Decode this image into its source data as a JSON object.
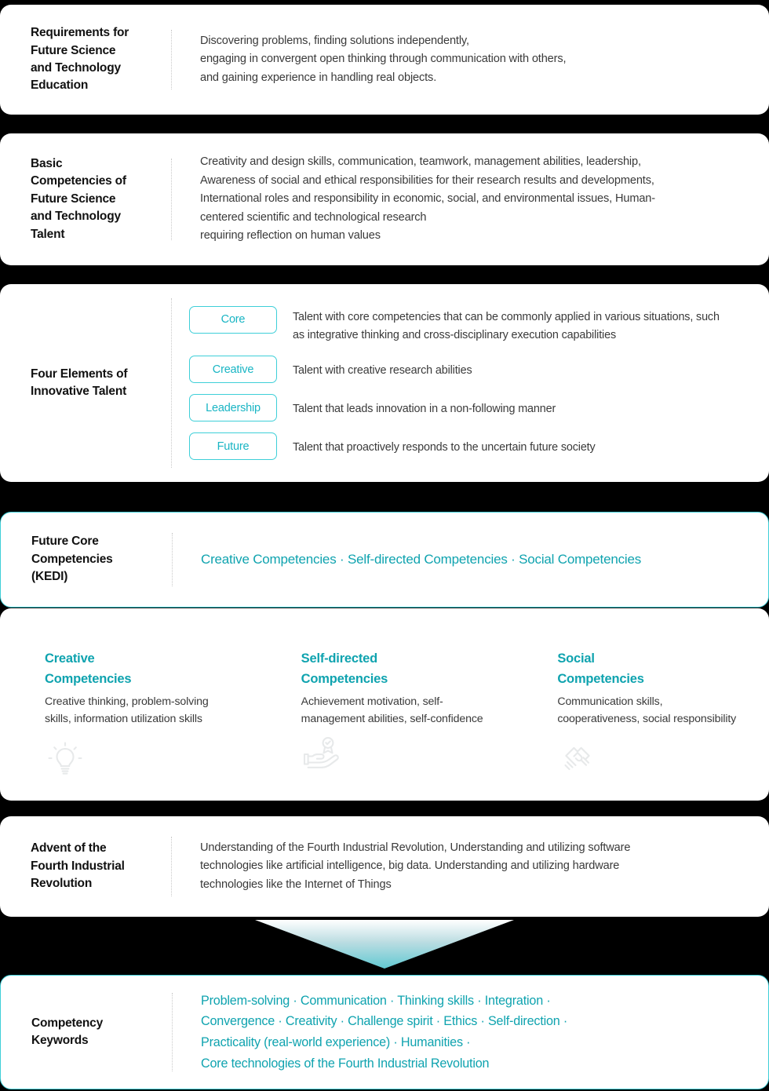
{
  "sections": {
    "requirements": {
      "label": "Requirements for\nFuture Science\nand Technology\nEducation",
      "lines": [
        "Discovering problems, finding solutions independently,",
        "engaging in convergent open thinking through communication with others,",
        "and gaining experience in handling real objects."
      ]
    },
    "basic_competencies": {
      "label": "Basic\nCompetencies of\nFuture Science\nand Technology\nTalent",
      "lines": [
        "Creativity and design skills, communication, teamwork, management abilities, leadership,",
        "Awareness of social and ethical responsibilities for their research results and developments,",
        "International roles and responsibility in economic, social, and environmental issues, Human-",
        "centered scientific and technological research",
        "requiring reflection on human values"
      ]
    },
    "four_elements": {
      "label": "Four Elements of\nInnovative Talent",
      "items": [
        {
          "pill": "Core",
          "desc": "Talent with core competencies that can be commonly applied in various situations, such as integrative thinking and cross-disciplinary execution capabilities"
        },
        {
          "pill": "Creative",
          "desc": "Talent with creative research abilities"
        },
        {
          "pill": "Leadership",
          "desc": "Talent that leads innovation in a non-following manner"
        },
        {
          "pill": "Future",
          "desc": "Talent that proactively responds to the uncertain future society"
        }
      ]
    },
    "future_core": {
      "label": "Future Core\nCompetencies\n(KEDI)",
      "text": "Creative Competencies · Self-directed Competencies · Social Competencies"
    },
    "competency_columns": [
      {
        "title": "Creative\nCompetencies",
        "desc": "Creative thinking, problem-solving skills, information utilization skills",
        "icon": "lightbulb-icon"
      },
      {
        "title": "Self-directed\nCompetencies",
        "desc": "Achievement motivation, self-management abilities, self-confidence",
        "icon": "hand-award-icon"
      },
      {
        "title": "Social\nCompetencies",
        "desc": "Communication skills, cooperativeness, social responsibility",
        "icon": "handshake-icon"
      }
    ],
    "fourth_industrial": {
      "label": "Advent of the\nFourth Industrial\nRevolution",
      "lines": [
        "Understanding of the Fourth Industrial Revolution, Understanding and utilizing software",
        "technologies like artificial intelligence, big data. Understanding and utilizing hardware",
        "technologies like the Internet of Things"
      ]
    },
    "arrow": {
      "icon": "down-arrow-icon"
    },
    "keywords": {
      "label": "Competency\nKeywords",
      "lines": [
        "Problem-solving · Communication · Thinking skills · Integration ·",
        "Convergence · Creativity · Challenge spirit · Ethics · Self-direction ·",
        "Practicality (real-world experience) · Humanities ·",
        "Core technologies of the Fourth Industrial Revolution"
      ]
    }
  },
  "colors": {
    "accent_teal": "#0fa3af",
    "pill_border": "#3ecfd8",
    "pill_text": "#19b5c4",
    "body_text": "#3a3a3a",
    "label_text": "#111111",
    "card_bg": "#ffffff",
    "page_bg": "#000000",
    "icon_gray": "#e7e9ea"
  }
}
